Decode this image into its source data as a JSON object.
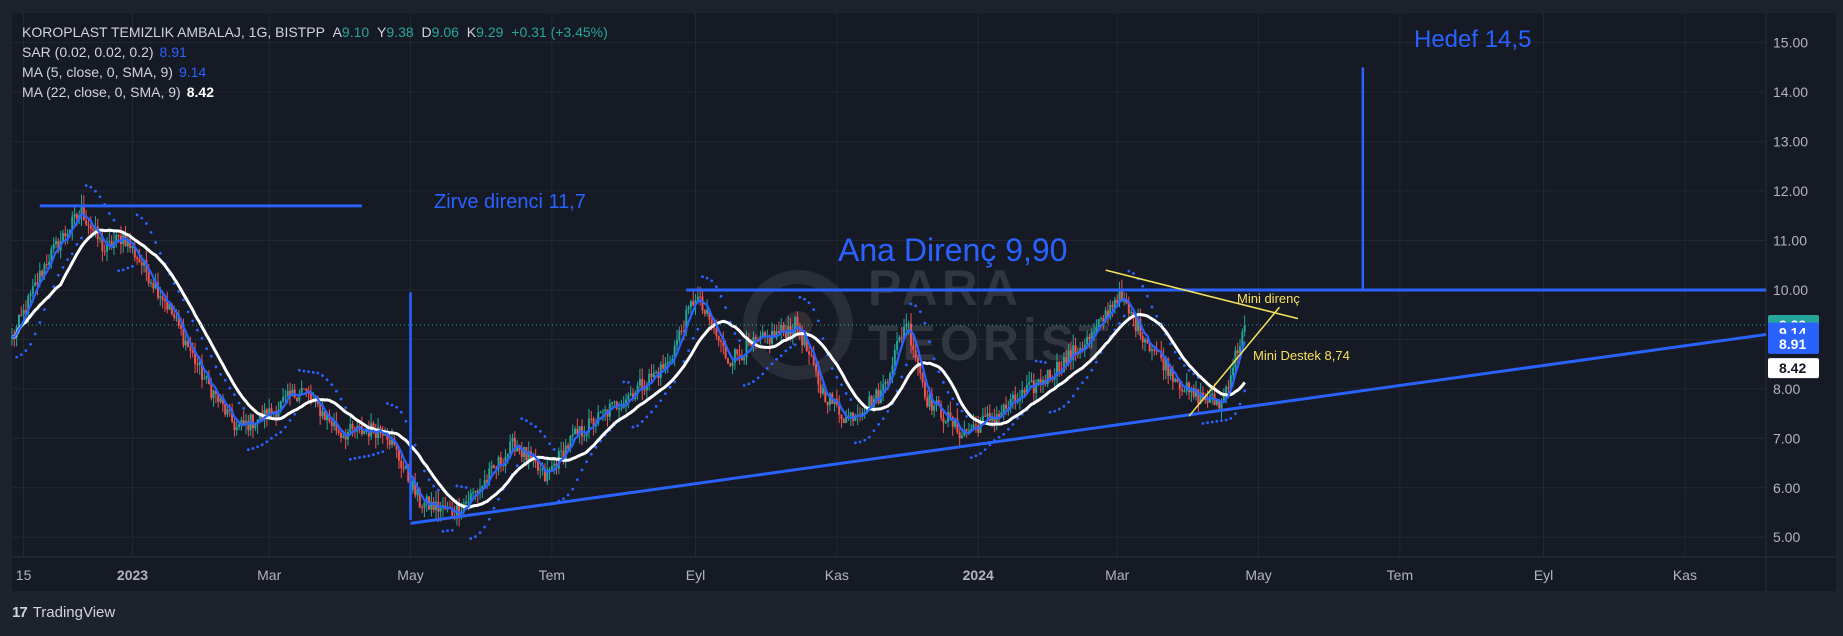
{
  "legend": {
    "symbol": "KOROPLAST TEMIZLIK AMBALAJ, 1G, BISTPP",
    "open_k": "A",
    "open": "9.10",
    "high_k": "Y",
    "high": "9.38",
    "low_k": "D",
    "low": "9.06",
    "close_k": "K",
    "close": "9.29",
    "change": "+0.31 (+3.45%)",
    "sar_label": "SAR (0.02, 0.02, 0.2)",
    "sar_value": "8.91",
    "ma5_label": "MA (5, close, 0, SMA, 9)",
    "ma5_value": "9.14",
    "ma22_label": "MA (22, close, 0, SMA, 9)",
    "ma22_value": "8.42"
  },
  "brand": {
    "name": "TradingView",
    "logo": "17"
  },
  "watermark": {
    "line1": "PARA",
    "line2": "TEORİST"
  },
  "colors": {
    "background": "#161a25",
    "up": "#26a69a",
    "down": "#ef5350",
    "sar": "#2962ff",
    "ma5": "#2962ff",
    "ma22": "#ffffff",
    "annotation_blue": "#2962ff",
    "annotation_yellow": "#f5e25b"
  },
  "chart_data": {
    "type": "candlestick",
    "title": "",
    "xlabel": "",
    "ylabel": "",
    "ylim": [
      4.6,
      15.6
    ],
    "y_ticks": [
      "5.00",
      "6.00",
      "7.00",
      "8.00",
      "9.00",
      "10.00",
      "11.00",
      "12.00",
      "13.00",
      "14.00",
      "15.00"
    ],
    "x_ticks": [
      {
        "label": "15",
        "date": "2022-11-15"
      },
      {
        "label": "2023",
        "date": "2023-01-01"
      },
      {
        "label": "Mar",
        "date": "2023-03-01"
      },
      {
        "label": "May",
        "date": "2023-05-01"
      },
      {
        "label": "Tem",
        "date": "2023-07-01"
      },
      {
        "label": "Eyl",
        "date": "2023-09-01"
      },
      {
        "label": "Kas",
        "date": "2023-11-01"
      },
      {
        "label": "2024",
        "date": "2024-01-01"
      },
      {
        "label": "Mar",
        "date": "2024-03-01"
      },
      {
        "label": "May",
        "date": "2024-05-01"
      },
      {
        "label": "Tem",
        "date": "2024-07-01"
      },
      {
        "label": "Eyl",
        "date": "2024-09-01"
      },
      {
        "label": "Kas",
        "date": "2024-11-01"
      }
    ],
    "xlim": [
      "2022-11-10",
      "2024-12-06"
    ],
    "grid": true,
    "last_price": 9.29,
    "price_path": [
      {
        "date": "2022-11-10",
        "price": 9.0
      },
      {
        "date": "2022-11-25",
        "price": 10.6
      },
      {
        "date": "2022-12-10",
        "price": 11.6
      },
      {
        "date": "2022-12-20",
        "price": 10.8
      },
      {
        "date": "2022-12-28",
        "price": 11.1
      },
      {
        "date": "2023-01-15",
        "price": 9.8
      },
      {
        "date": "2023-02-01",
        "price": 8.2
      },
      {
        "date": "2023-02-15",
        "price": 7.2
      },
      {
        "date": "2023-03-01",
        "price": 7.5
      },
      {
        "date": "2023-03-15",
        "price": 8.0
      },
      {
        "date": "2023-04-01",
        "price": 7.1
      },
      {
        "date": "2023-04-20",
        "price": 7.2
      },
      {
        "date": "2023-05-05",
        "price": 5.7
      },
      {
        "date": "2023-05-20",
        "price": 5.5
      },
      {
        "date": "2023-05-31",
        "price": 6.0
      },
      {
        "date": "2023-06-15",
        "price": 6.9
      },
      {
        "date": "2023-06-28",
        "price": 6.2
      },
      {
        "date": "2023-07-10",
        "price": 7.0
      },
      {
        "date": "2023-08-01",
        "price": 7.8
      },
      {
        "date": "2023-08-20",
        "price": 8.5
      },
      {
        "date": "2023-09-01",
        "price": 9.9
      },
      {
        "date": "2023-09-15",
        "price": 8.6
      },
      {
        "date": "2023-10-01",
        "price": 9.0
      },
      {
        "date": "2023-10-15",
        "price": 9.3
      },
      {
        "date": "2023-10-25",
        "price": 8.0
      },
      {
        "date": "2023-11-05",
        "price": 7.4
      },
      {
        "date": "2023-11-20",
        "price": 7.9
      },
      {
        "date": "2023-12-01",
        "price": 9.4
      },
      {
        "date": "2023-12-10",
        "price": 7.8
      },
      {
        "date": "2023-12-25",
        "price": 7.1
      },
      {
        "date": "2024-01-10",
        "price": 7.5
      },
      {
        "date": "2024-02-01",
        "price": 8.3
      },
      {
        "date": "2024-02-20",
        "price": 9.1
      },
      {
        "date": "2024-03-01",
        "price": 9.9
      },
      {
        "date": "2024-03-15",
        "price": 8.9
      },
      {
        "date": "2024-04-01",
        "price": 7.9
      },
      {
        "date": "2024-04-15",
        "price": 7.7
      },
      {
        "date": "2024-04-25",
        "price": 9.29
      }
    ],
    "series": [
      {
        "name": "SAR (0.02, 0.02, 0.2)",
        "last": 8.91
      },
      {
        "name": "MA (5, close, 0, SMA, 9)",
        "last": 9.14
      },
      {
        "name": "MA (22, close, 0, SMA, 9)",
        "last": 8.42
      }
    ],
    "price_labels": [
      {
        "value": 9.29,
        "text": "9.29",
        "bg": "#26a69a",
        "fg": "#ffffff"
      },
      {
        "value": 9.14,
        "text": "9.14",
        "bg": "#2962ff",
        "fg": "#ffffff"
      },
      {
        "value": 8.91,
        "text": "8.91",
        "bg": "#2962ff",
        "fg": "#ffffff"
      },
      {
        "value": 8.42,
        "text": "8.42",
        "bg": "#ffffff",
        "fg": "#131722"
      }
    ],
    "annotations": {
      "lines": [
        {
          "id": "zirve-line",
          "color": "blue",
          "from": {
            "date": "2022-11-22",
            "price": 11.7
          },
          "to": {
            "date": "2023-04-10",
            "price": 11.7
          }
        },
        {
          "id": "ana-direnc-line",
          "color": "blue",
          "from": {
            "date": "2023-08-28",
            "price": 10.0
          },
          "to": {
            "date": "2024-12-06",
            "price": 10.0
          }
        },
        {
          "id": "trend-support-line",
          "color": "blue",
          "from": {
            "date": "2023-05-01",
            "price": 5.28
          },
          "to": {
            "date": "2024-12-06",
            "price": 9.1
          }
        },
        {
          "id": "may-drop-line",
          "color": "blue",
          "from": {
            "date": "2023-05-01",
            "price": 9.95
          },
          "to": {
            "date": "2023-05-01",
            "price": 5.35
          }
        },
        {
          "id": "hedef-line",
          "color": "blue",
          "from": {
            "date": "2024-06-15",
            "price": 10.0
          },
          "to": {
            "date": "2024-06-15",
            "price": 14.5
          }
        },
        {
          "id": "mini-direnc-line",
          "color": "yellow",
          "from": {
            "date": "2024-02-25",
            "price": 10.4
          },
          "to": {
            "date": "2024-05-18",
            "price": 9.42
          }
        },
        {
          "id": "mini-destek-line",
          "color": "yellow",
          "from": {
            "date": "2024-04-01",
            "price": 7.45
          },
          "to": {
            "date": "2024-05-10",
            "price": 9.65
          }
        }
      ],
      "labels": [
        {
          "id": "zirve-label",
          "text": "Zirve direnci 11,7",
          "color": "blue",
          "size": "medium"
        },
        {
          "id": "ana-direnc-label",
          "text": "Ana Direnç 9,90",
          "color": "blue",
          "size": "large"
        },
        {
          "id": "hedef-label",
          "text": "Hedef 14,5",
          "color": "blue",
          "size": "medium"
        },
        {
          "id": "mini-direnc-label",
          "text": "Mini direnç",
          "color": "yellow",
          "size": "small"
        },
        {
          "id": "mini-destek-label",
          "text": "Mini Destek 8,74",
          "color": "yellow",
          "size": "small"
        }
      ]
    }
  }
}
